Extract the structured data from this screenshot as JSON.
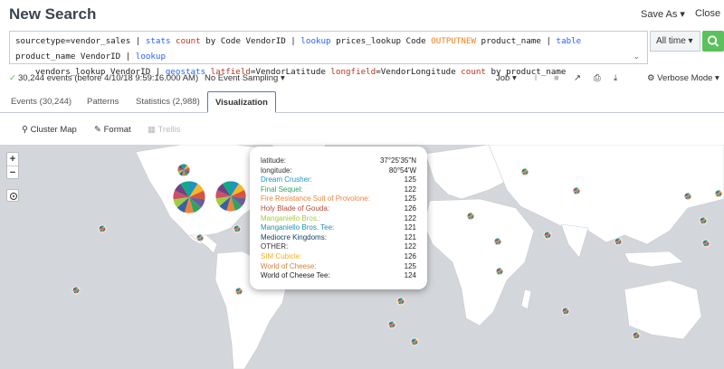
{
  "header": {
    "title": "New Search",
    "save_as": "Save As ▾",
    "close": "Close"
  },
  "search": {
    "l1": [
      {
        "t": "sourcetype=vendor_sales ",
        "c": "sp"
      },
      {
        "t": "| ",
        "c": "sp"
      },
      {
        "t": "stats ",
        "c": "kw"
      },
      {
        "t": "count ",
        "c": "fn"
      },
      {
        "t": "by Code VendorID ",
        "c": "sp"
      },
      {
        "t": "| ",
        "c": "sp"
      },
      {
        "t": "lookup ",
        "c": "kw"
      },
      {
        "t": "prices_lookup Code ",
        "c": "sp"
      },
      {
        "t": "OUTPUTNEW ",
        "c": "hl"
      },
      {
        "t": "product_name ",
        "c": "sp"
      },
      {
        "t": "| ",
        "c": "sp"
      },
      {
        "t": "table ",
        "c": "kw"
      },
      {
        "t": "product_name VendorID ",
        "c": "sp"
      },
      {
        "t": "| ",
        "c": "sp"
      },
      {
        "t": "lookup",
        "c": "kw"
      }
    ],
    "l2": [
      {
        "t": "vendors_lookup VendorID ",
        "c": "sp"
      },
      {
        "t": "| ",
        "c": "sp"
      },
      {
        "t": "geostats ",
        "c": "kw"
      },
      {
        "t": "latfield",
        "c": "fn"
      },
      {
        "t": "=VendorLatitude ",
        "c": "sp"
      },
      {
        "t": "longfield",
        "c": "fn"
      },
      {
        "t": "=VendorLongitude ",
        "c": "sp"
      },
      {
        "t": "count ",
        "c": "fn"
      },
      {
        "t": "by product_name",
        "c": "sp"
      }
    ],
    "chevron": "⌄",
    "time_range": "All time ▾"
  },
  "status": {
    "events": "30,244 events (before 4/10/18 9:59:16.000 AM)",
    "sampling": "No Event Sampling ▾",
    "job": "Job ▾",
    "mode": "Verbose Mode ▾"
  },
  "tabs": {
    "events": "Events (30,244)",
    "patterns": "Patterns",
    "statistics": "Statistics (2,988)",
    "visualization": "Visualization"
  },
  "viz_toolbar": {
    "cluster_map": "Cluster Map",
    "format": "Format",
    "trellis": "Trellis"
  },
  "tooltip": {
    "latitude_label": "latitude:",
    "latitude": "37°25'35\"N",
    "longitude_label": "longitude:",
    "longitude": "80°54'W",
    "rows": [
      {
        "name": "Dream Crusher:",
        "value": "125",
        "color": "#1e93c6"
      },
      {
        "name": "Final Sequel:",
        "value": "122",
        "color": "#31a35f"
      },
      {
        "name": "Fire Resistance Suit of Provolone:",
        "value": "125",
        "color": "#ed8440"
      },
      {
        "name": "Holy Blade of Gouda:",
        "value": "126",
        "color": "#ae4b3a"
      },
      {
        "name": "Manganiello Bros.:",
        "value": "122",
        "color": "#a2cc3e"
      },
      {
        "name": "Manganiello Bros. Tee:",
        "value": "121",
        "color": "#1e8eb6"
      },
      {
        "name": "Mediocre Kingdoms:",
        "value": "121",
        "color": "#1a3f66"
      },
      {
        "name": "OTHER:",
        "value": "122",
        "color": "#333333"
      },
      {
        "name": "SIM Cubicle:",
        "value": "126",
        "color": "#f5b122"
      },
      {
        "name": "World of Cheese:",
        "value": "125",
        "color": "#d6803d"
      },
      {
        "name": "World of Cheese Tee:",
        "value": "124",
        "color": "#222222"
      }
    ]
  },
  "map": {
    "zoom_in": "+",
    "zoom_out": "−",
    "land_color": "#ffffff",
    "water_color": "#d3d6da",
    "pie_colors": [
      "#1e93c6",
      "#f2b827",
      "#d6563c",
      "#6a5c9e",
      "#31a35f",
      "#ed8440",
      "#3863a0",
      "#a2cc3e",
      "#cc5068",
      "#73427f",
      "#11a88b"
    ]
  }
}
